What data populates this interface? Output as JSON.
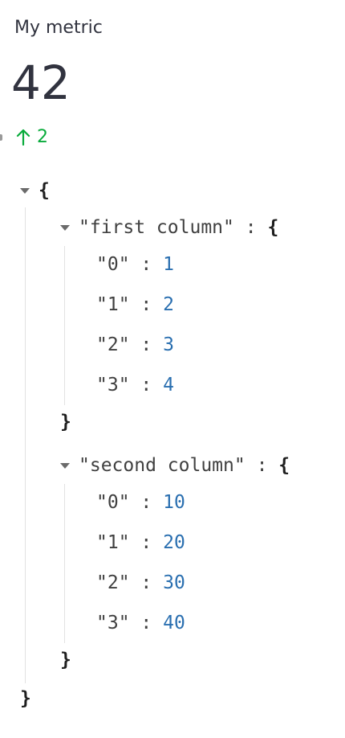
{
  "metric": {
    "label": "My metric",
    "value": "42",
    "delta": "2",
    "delta_direction": "up",
    "delta_color": "#09ab3b"
  },
  "json_view": {
    "open_brace": "{",
    "close_brace": "}",
    "colon": ":",
    "first_column": {
      "key": "\"first column\"",
      "entries": [
        {
          "key": "\"0\"",
          "value": "1"
        },
        {
          "key": "\"1\"",
          "value": "2"
        },
        {
          "key": "\"2\"",
          "value": "3"
        },
        {
          "key": "\"3\"",
          "value": "4"
        }
      ]
    },
    "second_column": {
      "key": "\"second column\"",
      "entries": [
        {
          "key": "\"0\"",
          "value": "10"
        },
        {
          "key": "\"1\"",
          "value": "20"
        },
        {
          "key": "\"2\"",
          "value": "30"
        },
        {
          "key": "\"3\"",
          "value": "40"
        }
      ]
    },
    "colors": {
      "number": "#2a6fb0",
      "brace": "#1e1e1e",
      "key": "#404040"
    }
  }
}
